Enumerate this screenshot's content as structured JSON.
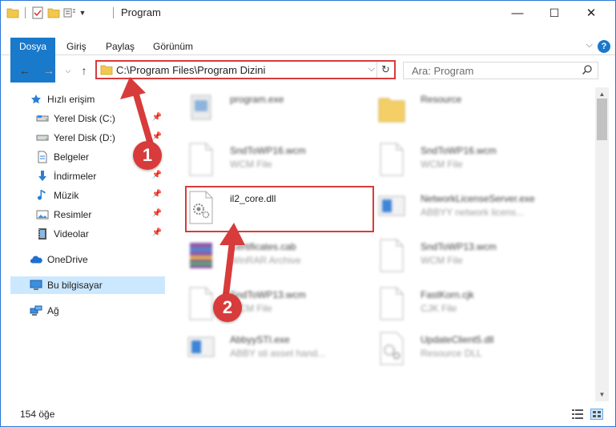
{
  "window": {
    "title": "Program",
    "minimize_glyph": "—",
    "maximize_glyph": "☐",
    "close_glyph": "✕"
  },
  "ribbon": {
    "tabs": [
      "Dosya",
      "Giriş",
      "Paylaş",
      "Görünüm"
    ],
    "help_glyph": "?"
  },
  "address": {
    "path": "C:\\Program Files\\Program Dizini",
    "search_placeholder": "Ara: Program"
  },
  "navigation": {
    "items": [
      {
        "label": "Hızlı erişim",
        "icon": "star-icon",
        "pinned": false
      },
      {
        "label": "Yerel Disk (C:)",
        "icon": "drive-icon",
        "pinned": true
      },
      {
        "label": "Yerel Disk (D:)",
        "icon": "drive-icon",
        "pinned": true
      },
      {
        "label": "Belgeler",
        "icon": "documents-icon",
        "pinned": true
      },
      {
        "label": "İndirmeler",
        "icon": "download-icon",
        "pinned": true
      },
      {
        "label": "Müzik",
        "icon": "music-icon",
        "pinned": true
      },
      {
        "label": "Resimler",
        "icon": "pictures-icon",
        "pinned": true
      },
      {
        "label": "Videolar",
        "icon": "videos-icon",
        "pinned": true
      },
      {
        "label": "OneDrive",
        "icon": "cloud-icon",
        "pinned": false
      },
      {
        "label": "Bu bilgisayar",
        "icon": "computer-icon",
        "pinned": false,
        "selected": true
      },
      {
        "label": "Ağ",
        "icon": "network-icon",
        "pinned": false
      }
    ]
  },
  "files": [
    {
      "name": "program.exe",
      "type": "",
      "icon": "exe-icon"
    },
    {
      "name": "Resource",
      "type": "",
      "icon": "folder-icon"
    },
    {
      "name": "SndToWP16.wcm",
      "type": "WCM File",
      "icon": "generic-file-icon"
    },
    {
      "name": "SndToWP16.wcm",
      "type": "WCM File",
      "icon": "generic-file-icon"
    },
    {
      "name": "il2_core.dll",
      "type": "",
      "icon": "dll-gear-icon"
    },
    {
      "name": "NetworkLicenseServer.exe",
      "type": "ABBYY network licens...",
      "icon": "app-window-icon"
    },
    {
      "name": "Certificates.cab",
      "type": "WinRAR Archive",
      "icon": "winrar-icon"
    },
    {
      "name": "SndToWP13.wcm",
      "type": "WCM File",
      "icon": "generic-file-icon"
    },
    {
      "name": "SndToWP13.wcm",
      "type": "WCM File",
      "icon": "generic-file-icon"
    },
    {
      "name": "FastKorn.cjk",
      "type": "CJK File",
      "icon": "generic-file-icon"
    },
    {
      "name": "AbbyySTI.exe",
      "type": "ABBY sti asset hand...",
      "icon": "app-window-icon"
    },
    {
      "name": "UpdateClient5.dll",
      "type": "Resource DLL",
      "icon": "dll-gear-icon"
    }
  ],
  "status": {
    "count": "154 öğe"
  },
  "annotations": {
    "badge_1": "1",
    "badge_2": "2"
  },
  "colors": {
    "accent": "#1979ca",
    "annotation_red": "#d83b3b",
    "selection": "#cce8ff"
  }
}
